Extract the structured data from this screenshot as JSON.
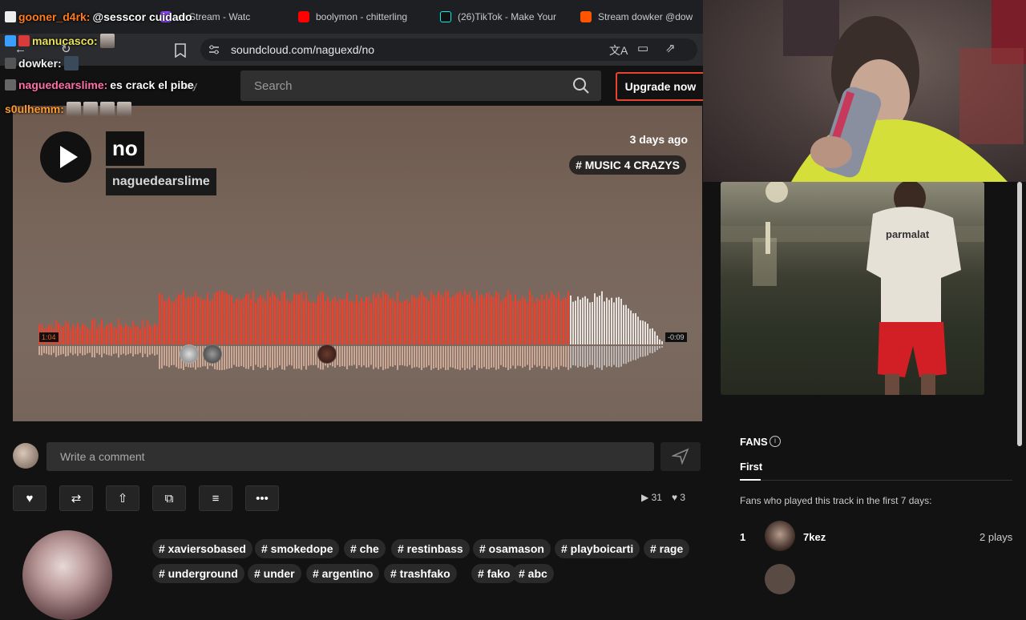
{
  "browser": {
    "tabs": [
      {
        "label": "er Stream - Watc",
        "icon": "twitch-icon",
        "color": "#9146ff"
      },
      {
        "label": "boolymon - chitterling",
        "icon": "youtube-icon",
        "color": "#ff0000"
      },
      {
        "label": "(26)TikTok - Make Your",
        "icon": "tiktok-icon",
        "color": "#111111"
      },
      {
        "label": "Stream dowker @dow",
        "icon": "soundcloud-icon",
        "color": "#ff5500"
      }
    ],
    "url": "soundcloud.com/naguexd/no"
  },
  "header": {
    "library_ghost": "ary",
    "search_placeholder": "Search",
    "upgrade_label": "Upgrade now"
  },
  "track": {
    "title": "no",
    "artist": "naguedearslime",
    "posted": "3 days ago",
    "genre": "# MUSIC 4 CRAZYS",
    "time_elapsed": "1:04",
    "time_remaining": "-0:09",
    "progress": 0.85,
    "accent": "#e8432f"
  },
  "comment": {
    "placeholder": "Write a comment"
  },
  "stats": {
    "plays": "31",
    "likes": "3"
  },
  "tags": [
    "# xaviersobased",
    "# smokedope",
    "# che",
    "# restinbass",
    "# osamason",
    "# playboicarti",
    "# rage",
    "# underground",
    "# under",
    "# argentino",
    "# trashfako",
    "# fako",
    "# abc"
  ],
  "fans": {
    "title": "FANS",
    "tab": "First",
    "description": "Fans who played this track in the first 7 days:",
    "entries": [
      {
        "rank": "1",
        "name": "7kez",
        "plays": "2 plays"
      }
    ]
  },
  "artwork_text": "parmalat",
  "chat": [
    {
      "user": "gooner_d4rk:",
      "user_color": "#ff7b1c",
      "text": "@sesscor cuidado"
    },
    {
      "user": "manucasco:",
      "user_color": "#e8e25a",
      "text": ""
    },
    {
      "user": "dowker:",
      "user_color": "#f2f2f2",
      "text": ""
    },
    {
      "user": "naguedearslime:",
      "user_color": "#ff6fa8",
      "text": "es crack el pibe"
    },
    {
      "user": "s0ulhemm:",
      "user_color": "#ff9a2e",
      "text": ""
    }
  ]
}
